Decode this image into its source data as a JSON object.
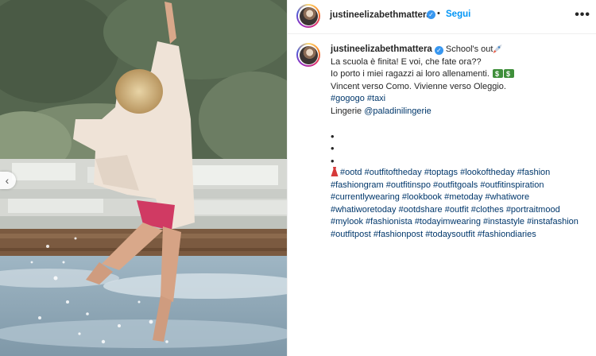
{
  "post": {
    "username": "justineelizabethmattera",
    "follow_label": "Segui",
    "separator": "•",
    "more_label": "•••",
    "verified_glyph": "✓",
    "prev_glyph": "‹"
  },
  "caption": {
    "username": "justineelizabethmattera",
    "line1": "School's out",
    "line2": "La scuola è finita! E voi, che fate ora??",
    "line3": "Io porto i miei ragazzi ai loro allenamenti.",
    "line4": "Vincent verso Como. Vivienne verso Oleggio.",
    "tags1": [
      "#gogogo",
      "#taxi"
    ],
    "lingerie_label": "Lingerie",
    "lingerie_mention": "@paladinilingerie",
    "bullets": [
      "•",
      "•",
      "•"
    ],
    "hashtags": [
      [
        "#ootd",
        "#outfitoftheday",
        "#toptags",
        "#lookoftheday",
        "#fashion"
      ],
      [
        "#fashiongram",
        "#outfitinspo",
        "#outfitgoals",
        "#outfitinspiration"
      ],
      [
        "#currentlywearing",
        "#lookbook",
        "#metoday",
        "#whatiwore"
      ],
      [
        "#whatiworetoday",
        "#ootdshare",
        "#outfit",
        "#clothes",
        "#portraitmood"
      ],
      [
        "#mylook",
        "#fashionista",
        "#todayimwearing",
        "#instastyle",
        "#instafashion"
      ],
      [
        "#outfitpost",
        "#fashionpost",
        "#todaysoutfit",
        "#fashiondiaries"
      ]
    ]
  },
  "icons": {
    "prev": "chevron-left-icon",
    "verified": "verified-badge-icon",
    "more": "more-options-icon",
    "rocket": "rocket-emoji",
    "money": "money-emoji",
    "dress": "dress-emoji"
  },
  "colors": {
    "link_blue": "#0095f6",
    "hashtag": "#00376b",
    "text": "#262626",
    "verified": "#3897f0"
  }
}
